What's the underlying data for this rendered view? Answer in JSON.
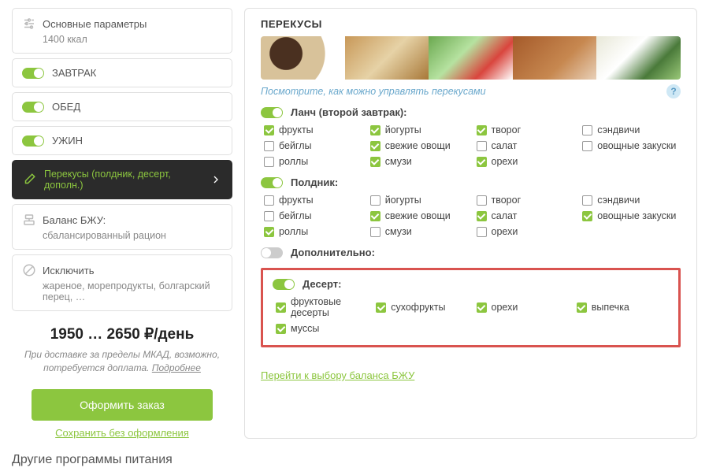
{
  "sidebar": {
    "params": {
      "title": "Основные параметры",
      "value": "1400 ккал"
    },
    "meals": [
      {
        "label": "ЗАВТРАК",
        "on": true
      },
      {
        "label": "ОБЕД",
        "on": true
      },
      {
        "label": "УЖИН",
        "on": true
      }
    ],
    "snacks": {
      "label": "Перекусы (полдник, десерт, дополн.)"
    },
    "bju": {
      "title": "Баланс БЖУ:",
      "value": "сбалансированный рацион"
    },
    "exclude": {
      "title": "Исключить",
      "value": "жареное, морепродукты, болгарский перец, …"
    },
    "price": {
      "range": "1950 … 2650 ₽/день",
      "note": "При доставке за пределы МКАД, возможно, потребуется доплата.",
      "more": "Подробнее"
    },
    "actions": {
      "order": "Оформить заказ",
      "save": "Сохранить без оформления"
    }
  },
  "main": {
    "title": "ПЕРЕКУСЫ",
    "hint": "Посмотрите, как можно управлять перекусами",
    "blocks": [
      {
        "name": "Ланч (второй завтрак):",
        "on": true,
        "items": [
          {
            "label": "фрукты",
            "checked": true
          },
          {
            "label": "йогурты",
            "checked": true
          },
          {
            "label": "творог",
            "checked": true
          },
          {
            "label": "сэндвичи",
            "checked": false
          },
          {
            "label": "бейглы",
            "checked": false
          },
          {
            "label": "свежие овощи",
            "checked": true
          },
          {
            "label": "салат",
            "checked": false
          },
          {
            "label": "овощные закуски",
            "checked": false
          },
          {
            "label": "роллы",
            "checked": false
          },
          {
            "label": "смузи",
            "checked": true
          },
          {
            "label": "орехи",
            "checked": true
          }
        ]
      },
      {
        "name": "Полдник:",
        "on": true,
        "items": [
          {
            "label": "фрукты",
            "checked": false
          },
          {
            "label": "йогурты",
            "checked": false
          },
          {
            "label": "творог",
            "checked": false
          },
          {
            "label": "сэндвичи",
            "checked": false
          },
          {
            "label": "бейглы",
            "checked": false
          },
          {
            "label": "свежие овощи",
            "checked": true
          },
          {
            "label": "салат",
            "checked": true
          },
          {
            "label": "овощные закуски",
            "checked": true
          },
          {
            "label": "роллы",
            "checked": true
          },
          {
            "label": "смузи",
            "checked": false
          },
          {
            "label": "орехи",
            "checked": false
          }
        ]
      },
      {
        "name": "Дополнительно:",
        "on": false,
        "items": []
      },
      {
        "name": "Десерт:",
        "on": true,
        "highlight": true,
        "items": [
          {
            "label": "фруктовые десерты",
            "checked": true
          },
          {
            "label": "сухофрукты",
            "checked": true
          },
          {
            "label": "орехи",
            "checked": true
          },
          {
            "label": "выпечка",
            "checked": true
          },
          {
            "label": "муссы",
            "checked": true
          }
        ]
      }
    ],
    "next": "Перейти к выбору баланса БЖУ"
  },
  "footer": {
    "title": "Другие программы питания"
  }
}
